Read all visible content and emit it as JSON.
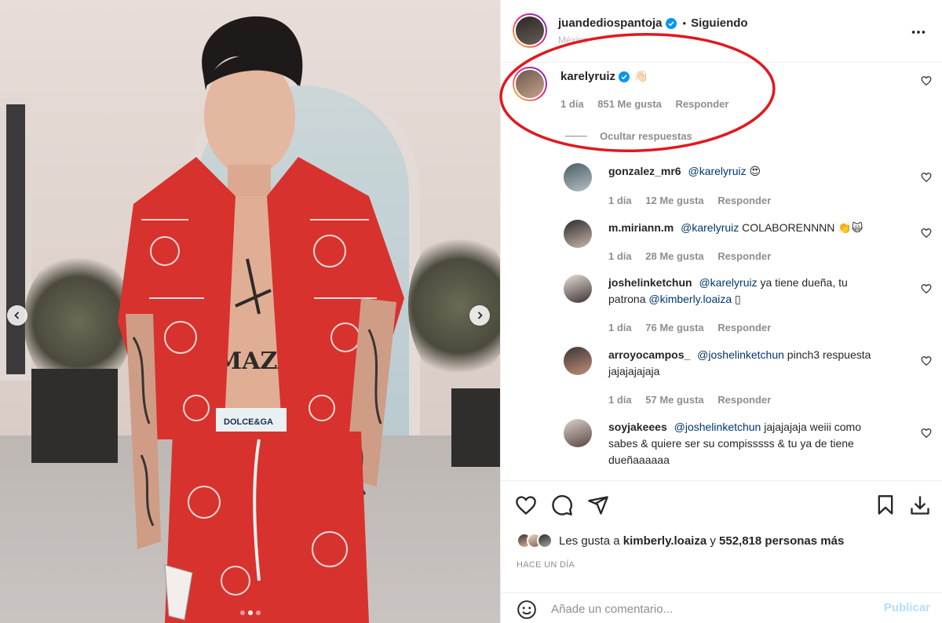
{
  "post": {
    "author": "juandediospantoja",
    "separator": "•",
    "follow_status": "Siguiendo",
    "location": "México",
    "more_icon": "more-horizontal-icon"
  },
  "comments": [
    {
      "user": "karelyruiz",
      "verified": true,
      "text": "👋🏻",
      "time": "1 día",
      "likes": "851 Me gusta",
      "reply": "Responder",
      "hide_replies": "Ocultar respuestas"
    }
  ],
  "replies": [
    {
      "user": "gonzalez_mr6",
      "mention": "@karelyruiz",
      "text": "😍",
      "time": "1 día",
      "likes": "12 Me gusta",
      "reply": "Responder"
    },
    {
      "user": "m.miriann.m",
      "mention": "@karelyruiz",
      "text": "COLABORENNNN 👏🙀",
      "time": "1 día",
      "likes": "28 Me gusta",
      "reply": "Responder"
    },
    {
      "user": "joshelinketchun",
      "mention": "@karelyruiz",
      "text": "ya tiene dueña, tu",
      "text2_pre": "patrona",
      "mention2": "@kimberly.loaiza",
      "text2_post": "▯",
      "time": "1 día",
      "likes": "76 Me gusta",
      "reply": "Responder"
    },
    {
      "user": "arroyocampos_",
      "mention": "@joshelinketchun",
      "text": "pinch3 respuesta",
      "text2": "jajajajajaja",
      "time": "1 día",
      "likes": "57 Me gusta",
      "reply": "Responder"
    },
    {
      "user": "soyjakeees",
      "mention": "@joshelinketchun",
      "text": "jajajajaja weiii como",
      "text2": "sabes & quiere ser su compisssss & tu ya de tiene",
      "text3": "dueñaaaaaa"
    }
  ],
  "actions": {
    "like_icon": "heart-icon",
    "comment_icon": "comment-icon",
    "share_icon": "send-icon",
    "save_icon": "bookmark-icon",
    "download_icon": "download-icon"
  },
  "likes_summary": {
    "prefix": "Les gusta a",
    "user": "kimberly.loaiza",
    "connector": "y",
    "count": "552,818 personas más"
  },
  "time_ago": "HACE UN DÍA",
  "add_comment": {
    "placeholder": "Añade un comentario...",
    "publish_label": "Publicar",
    "emoji_icon": "smiley-icon"
  },
  "colors": {
    "highlight_ellipse": "#e0191f",
    "verified_blue": "#0095f6",
    "mention_blue": "#00376b",
    "muted_gray": "#8e8e8e",
    "publish_disabled": "#b2dffc",
    "shirt_red": "#d8322e"
  },
  "carousel": {
    "prev_icon": "chevron-left-icon",
    "next_icon": "chevron-right-icon",
    "slides": 3,
    "active_slide": 2
  }
}
